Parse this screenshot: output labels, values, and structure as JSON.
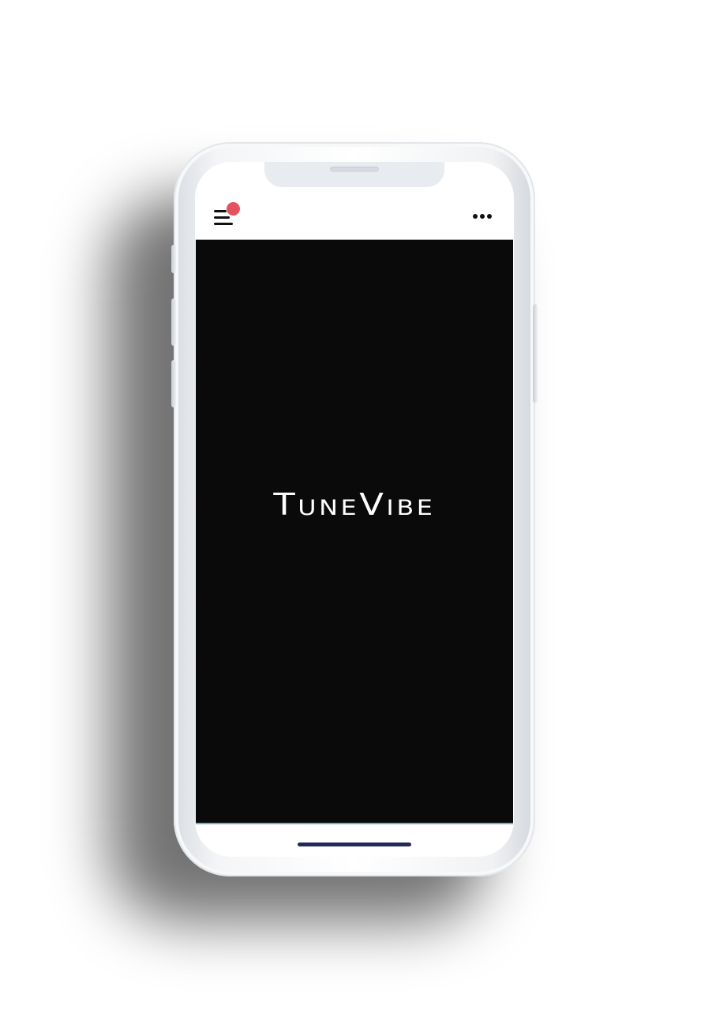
{
  "app": {
    "brand": "TuneVibe"
  },
  "topbar": {
    "menu_icon": "hamburger-menu-icon",
    "notification_icon": "notification-dot-icon",
    "more_icon": "more-horizontal-icon"
  },
  "colors": {
    "splash_background": "#0a0a0a",
    "brand_text": "#ffffff",
    "notification_dot": "#e4525f",
    "home_indicator": "#232a5a"
  }
}
